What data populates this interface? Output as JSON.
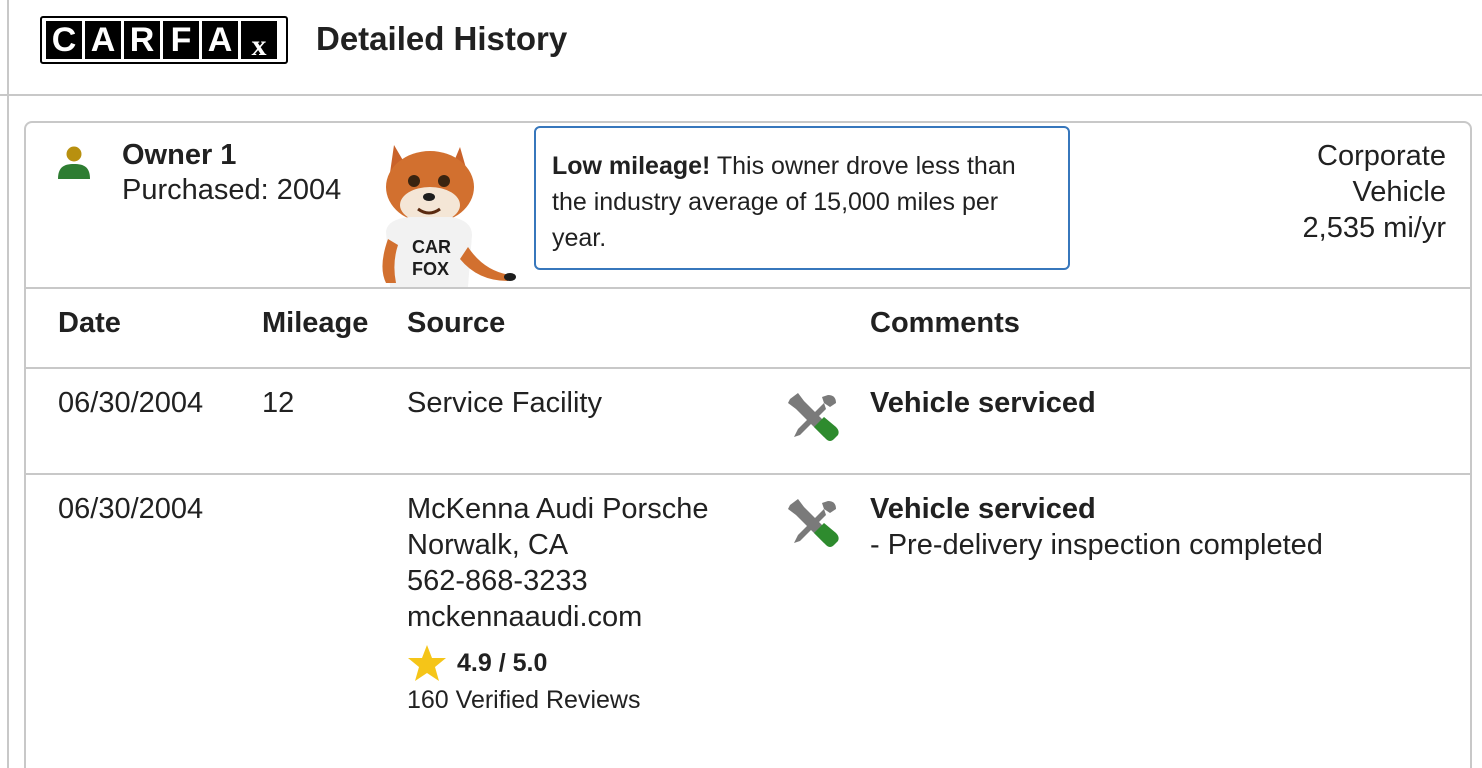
{
  "header": {
    "logo_letters": [
      "C",
      "A",
      "R",
      "F",
      "A",
      "x"
    ],
    "title": "Detailed History"
  },
  "owner": {
    "name": "Owner 1",
    "purchased": "Purchased: 2004",
    "type_lines": [
      "Corporate",
      "Vehicle",
      "2,535 mi/yr"
    ]
  },
  "callout": {
    "bold": "Low mileage!",
    "text": " This owner drove less than the industry average of 15,000 miles per year."
  },
  "table": {
    "headers": {
      "date": "Date",
      "mileage": "Mileage",
      "source": "Source",
      "comments": "Comments"
    },
    "rows": [
      {
        "date": "06/30/2004",
        "mileage": "12",
        "source_lines": [
          "Service Facility"
        ],
        "comment_title": "Vehicle serviced",
        "comment_details": []
      },
      {
        "date": "06/30/2004",
        "mileage": "",
        "source_lines": [
          "McKenna Audi Porsche",
          "Norwalk, CA",
          "562-868-3233",
          "mckennaaudi.com"
        ],
        "rating": "4.9 / 5.0",
        "reviews": "160 Verified Reviews",
        "comment_title": "Vehicle serviced",
        "comment_details": [
          "- Pre-delivery inspection completed"
        ]
      }
    ]
  },
  "colors": {
    "callout_border": "#3777bc",
    "owner_icon_head": "#b8900f",
    "owner_icon_body": "#2e7d32",
    "wrench_gray": "#7a7a7a",
    "screwdriver_green": "#2e8b2e",
    "star": "#f5c518"
  },
  "icons": {
    "owner": "person-icon",
    "service": "wrench-screwdriver-icon",
    "rating": "star-icon"
  }
}
